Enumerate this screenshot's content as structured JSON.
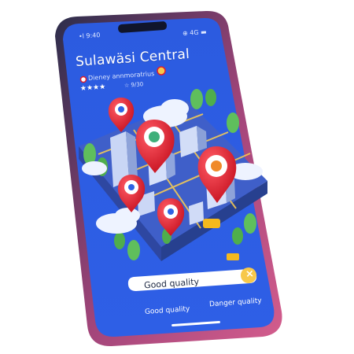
{
  "status_bar": {
    "left_text": "•l 9:40",
    "right_text": "⊕ 4G ▬"
  },
  "header": {
    "title": "Sulawäsi Central",
    "subtitle": "Dieney annmoratrius",
    "stars": "★★★★",
    "rating": "☆ 9/30"
  },
  "search": {
    "value": "Good quality",
    "clear_label": "×"
  },
  "legend": {
    "good_label": "Good quality",
    "danger_label": "Danger quality"
  },
  "colors": {
    "phone_frame": "#c34a7e",
    "screen_blue": "#2f63e3",
    "pin_red": "#e11d2a",
    "search_accent": "#f7c84a"
  }
}
